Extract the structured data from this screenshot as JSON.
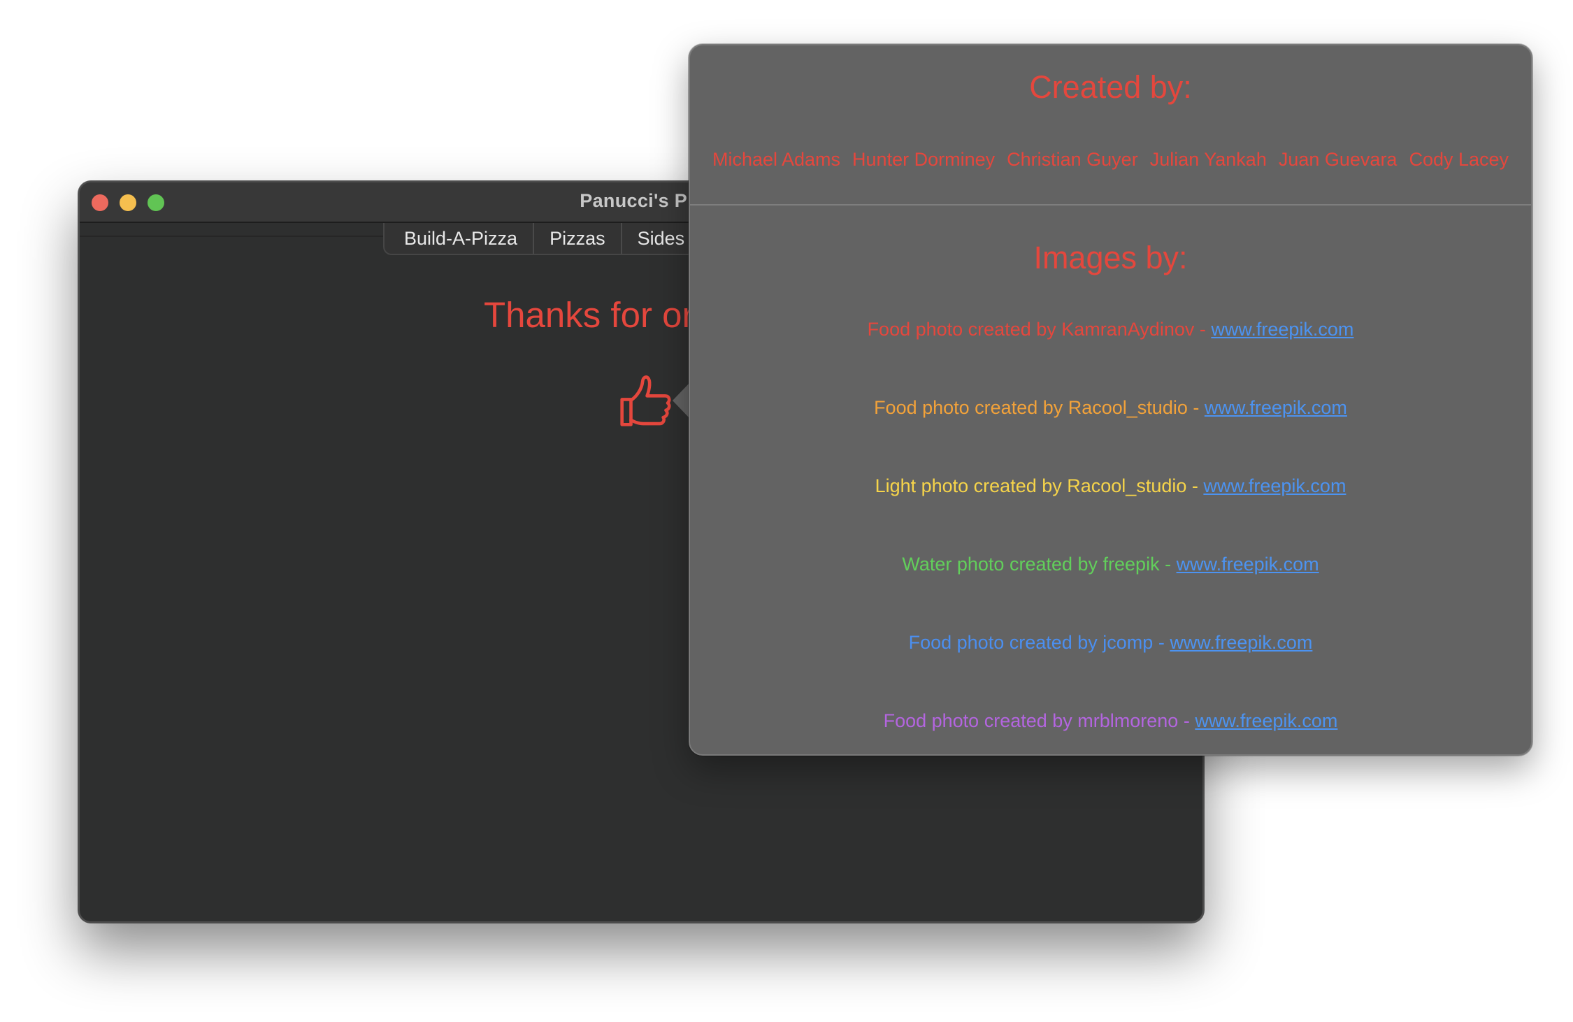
{
  "window": {
    "title": "Panucci's Piz",
    "tabs": [
      "Build-A-Pizza",
      "Pizzas",
      "Sides"
    ],
    "thanks_text": "Thanks for or"
  },
  "popover": {
    "created_heading": "Created by:",
    "creators": [
      "Michael Adams",
      "Hunter Dorminey",
      "Christian Guyer",
      "Julian Yankah",
      "Juan Guevara",
      "Cody Lacey"
    ],
    "images_heading": "Images by:",
    "credits": [
      {
        "text": "Food photo created by KamranAydinov - ",
        "link": "www.freepik.com",
        "color": "#e5473d"
      },
      {
        "text": "Food photo created by Racool_studio - ",
        "link": "www.freepik.com",
        "color": "#f2a23a"
      },
      {
        "text": "Light photo created by Racool_studio - ",
        "link": "www.freepik.com",
        "color": "#f6d44a"
      },
      {
        "text": "Water photo created by freepik - ",
        "link": "www.freepik.com",
        "color": "#62cf5b"
      },
      {
        "text": "Food photo created by jcomp - ",
        "link": "www.freepik.com",
        "color": "#4b8ff0"
      },
      {
        "text": "Food photo created by mrblmoreno - ",
        "link": "www.freepik.com",
        "color": "#b465e0"
      }
    ]
  },
  "colors": {
    "accent": "#e5473d",
    "link": "#4c93f1",
    "window_bg": "#2e2f2f",
    "popover_bg": "#636363"
  },
  "icons": {
    "thumb": "thumbs-up-icon"
  }
}
